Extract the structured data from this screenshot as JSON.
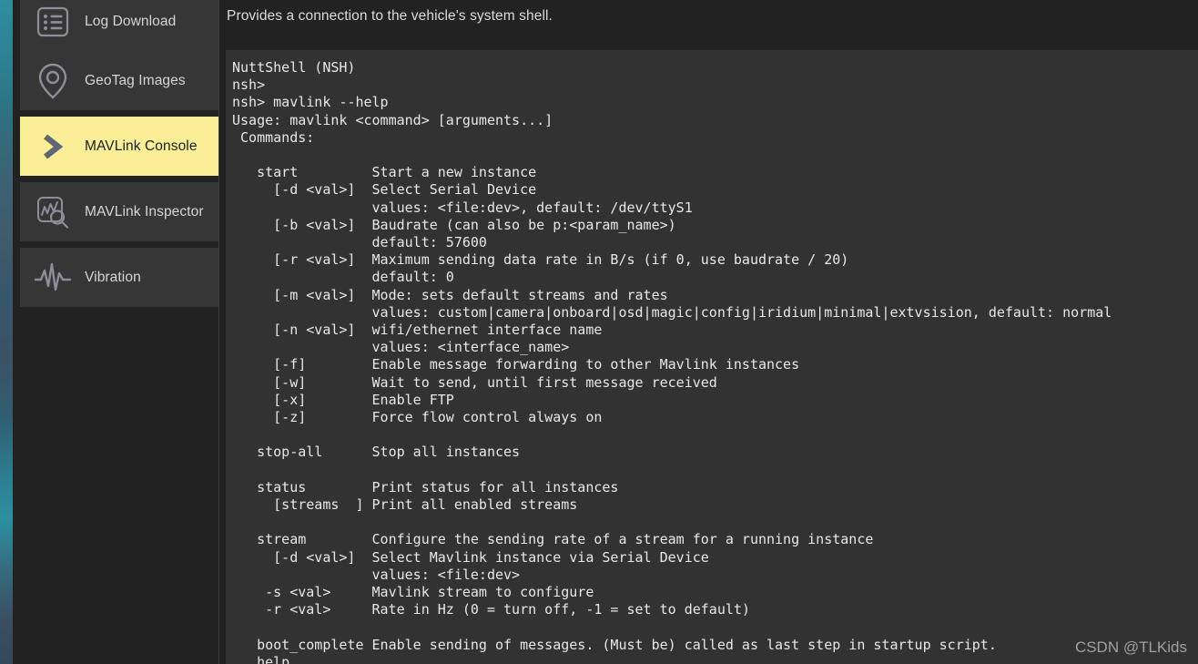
{
  "background": {
    "strip_colors": [
      "#2e8e9e",
      "#3b6272",
      "#37566a",
      "#2b8fa2",
      "#34485a"
    ]
  },
  "theme": {
    "window_bg": "#222222",
    "nav_item_bg": "#363636",
    "nav_selected_bg": "#faee96",
    "nav_label_color": "#d6d6d6",
    "nav_selected_label_color": "#1d1d1d",
    "console_bg": "#323232",
    "console_text_color": "#e8e8e8",
    "divider_color": "#3a3a3a"
  },
  "sidebar": {
    "items": [
      {
        "label": "Log Download",
        "icon": "log-list-icon",
        "selected": false
      },
      {
        "label": "GeoTag Images",
        "icon": "map-pin-icon",
        "selected": false
      },
      {
        "label": "MAVLink Console",
        "icon": "chevron-right-icon",
        "selected": true
      },
      {
        "label": "MAVLink Inspector",
        "icon": "chart-magnifier-icon",
        "selected": false
      },
      {
        "label": "Vibration",
        "icon": "waveform-icon",
        "selected": false
      }
    ]
  },
  "main": {
    "description": "Provides a connection to the vehicle's system shell.",
    "console": {
      "text": "NuttShell (NSH)\nnsh>\nnsh> mavlink --help\nUsage: mavlink <command> [arguments...]\n Commands:\n\n   start         Start a new instance\n     [-d <val>]  Select Serial Device\n                 values: <file:dev>, default: /dev/ttyS1\n     [-b <val>]  Baudrate (can also be p:<param_name>)\n                 default: 57600\n     [-r <val>]  Maximum sending data rate in B/s (if 0, use baudrate / 20)\n                 default: 0\n     [-m <val>]  Mode: sets default streams and rates\n                 values: custom|camera|onboard|osd|magic|config|iridium|minimal|extvsision, default: normal\n     [-n <val>]  wifi/ethernet interface name\n                 values: <interface_name>\n     [-f]        Enable message forwarding to other Mavlink instances\n     [-w]        Wait to send, until first message received\n     [-x]        Enable FTP\n     [-z]        Force flow control always on\n\n   stop-all      Stop all instances\n\n   status        Print status for all instances\n     [streams  ] Print all enabled streams\n\n   stream        Configure the sending rate of a stream for a running instance\n     [-d <val>]  Select Mavlink instance via Serial Device\n                 values: <file:dev>\n    -s <val>     Mavlink stream to configure\n    -r <val>     Rate in Hz (0 = turn off, -1 = set to default)\n\n   boot_complete Enable sending of messages. (Must be) called as last step in startup script.\n   help"
    }
  },
  "watermark": {
    "text": "CSDN @TLKids"
  }
}
